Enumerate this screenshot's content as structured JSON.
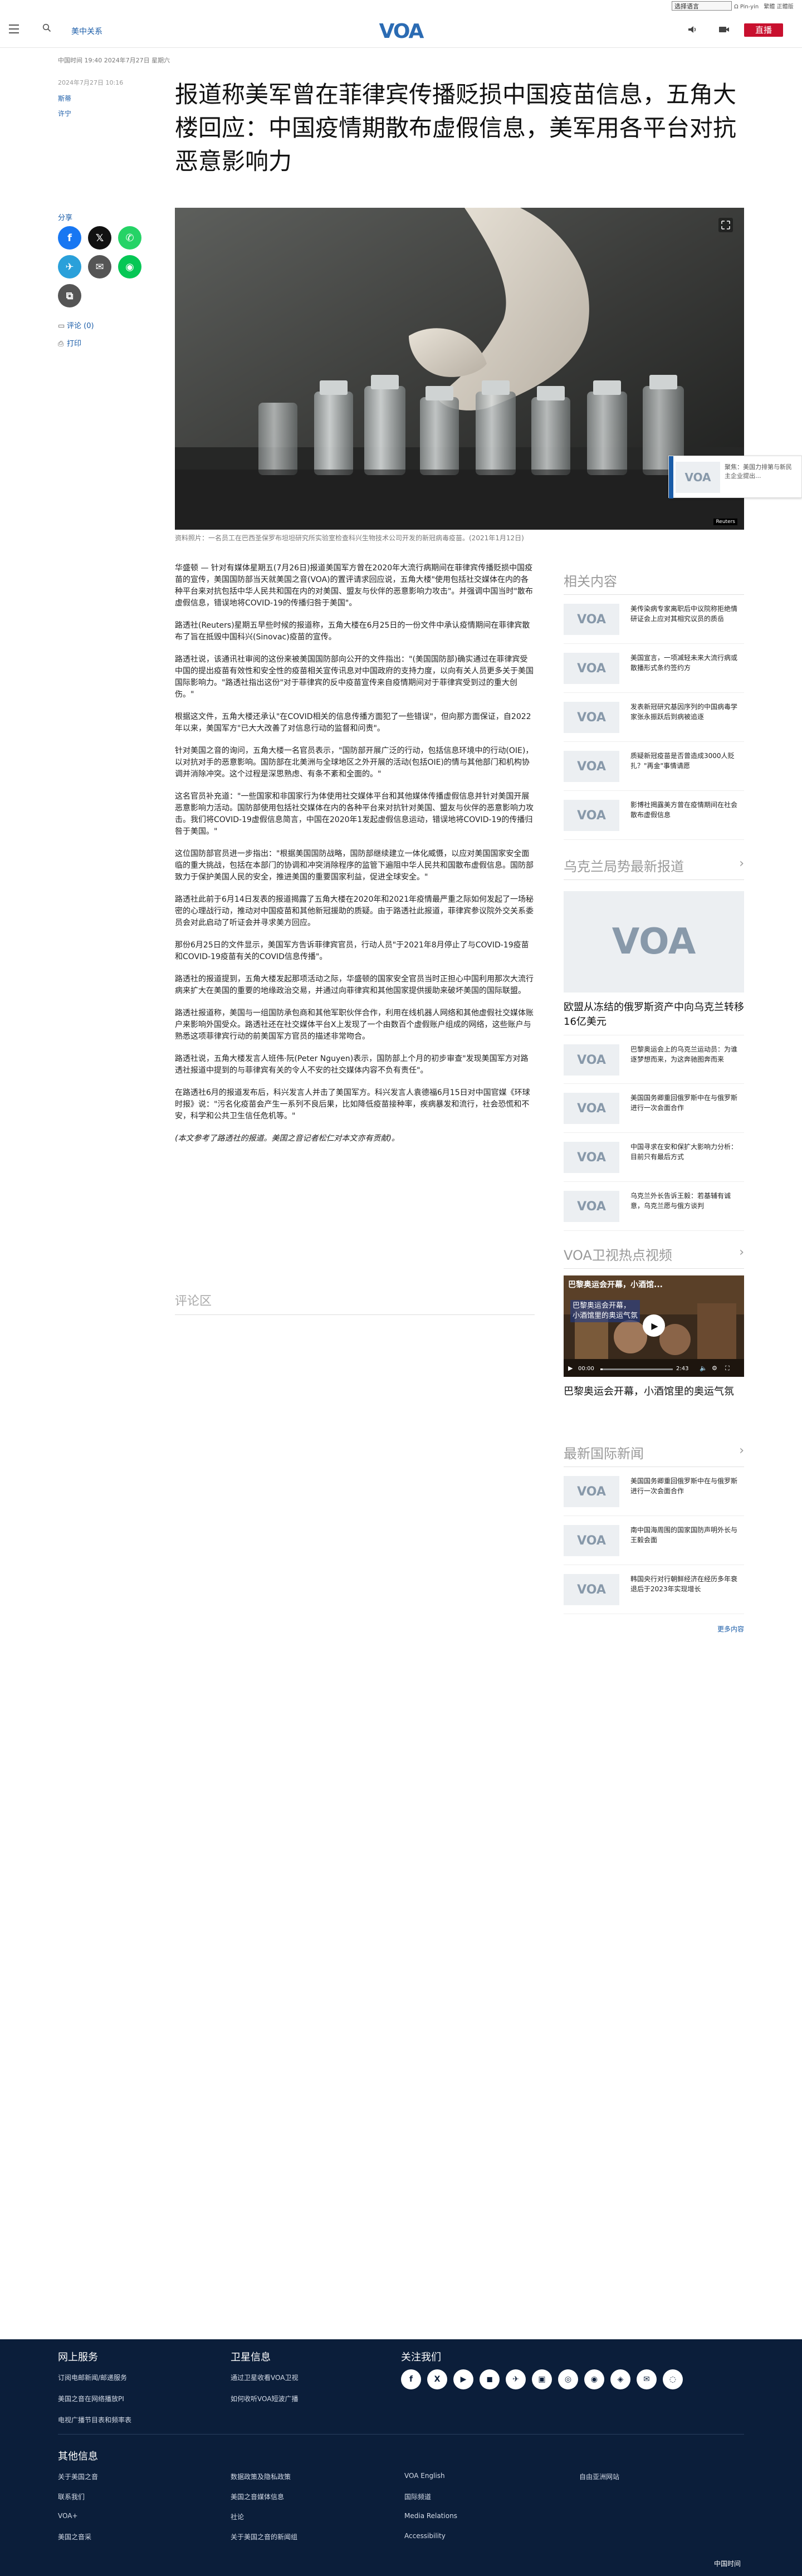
{
  "util": {
    "language_select": "选择语言",
    "links": [
      "Ω Pin-yin",
      "繁體 正體版"
    ]
  },
  "header": {
    "section": "美中关系",
    "logo": "VOA",
    "live": "直播"
  },
  "article": {
    "meta": "中国时间 19:40 2024年7月27日 星期六",
    "date_line": "2024年7月27日 10:16",
    "authors": [
      "斯蒂",
      "许宁"
    ],
    "headline": "报道称美军曾在菲律宾传播贬损中国疫苗信息，五角大楼回应：中国疫情期散布虚假信息，美军用各平台对抗恶意影响力",
    "share_label": "分享",
    "comments_link": "评论 (0)",
    "print_link": "打印",
    "caption": "资料照片：一名员工在巴西圣保罗布坦坦研究所实验室检查科兴生物技术公司开发的新冠病毒疫苗。(2021年1月12日)",
    "hero_badge": "Reuters",
    "paragraphs": [
      "华盛顿 — 针对有媒体星期五(7月26日)报道美国军方曾在2020年大流行病期间在菲律宾传播贬损中国疫苗的宣传，美国国防部当天就美国之音(VOA)的置评请求回应说，五角大楼\"使用包括社交媒体在内的各种平台来对抗包括中华人民共和国在内的对美国、盟友与伙伴的恶意影响力攻击\"。并强调中国当时\"散布虚假信息，错误地将COVID-19的传播归咎于美国\"。",
      "路透社(Reuters)星期五早些时候的报道称，五角大楼在6月25日的一份文件中承认疫情期间在菲律宾散布了旨在抵毁中国科兴(Sinovac)疫苗的宣传。",
      "路透社说，该通讯社审阅的这份来被美国国防部向公开的文件指出：\"(美国国防部)确实通过在菲律宾受中国的提出疫苗有效性和安全性的疫苗相关宣传讯息对中国政府的支持力度，以向有关人员更多关于美国国际影响力。\"路透社指出这份\"对于菲律宾的反中疫苗宣传来自疫情期间对于菲律宾受到过的重大创伤。\"",
      "根据这文件，五角大楼还承认\"在COVID相关的信息传播方面犯了一些错误\"，但向那方面保证，自2022年以来，美国军方\"已大大改善了对信息行动的监督和问责\"。",
      "针对美国之音的询问，五角大楼一名官员表示，\"国防部开展广泛的行动，包括信息环境中的行动(OIE)，以对抗对手的恶意影响。国防部在北美洲与全球地区之外开展的活动(包括OIE)的情与其他部门和机构协调并消除冲突。这个过程是深思熟虑、有条不紊和全面的。\"",
      "这名官员补充道：\"一些国家和非国家行为体使用社交媒体平台和其他媒体传播虚假信息并针对美国开展恶意影响力活动。国防部使用包括社交媒体在内的各种平台来对抗针对美国、盟友与伙伴的恶意影响力攻击。我们将COVID-19虚假信息简言，中国在2020年1发起虚假信息运动，错误地将COVID-19的传播归咎于美国。\"",
      "这位国防部官员进一步指出：\"根据美国国防战略，国防部继续建立一体化威慑，以应对美国国家安全面临的重大挑战，包括在本部门的协调和冲突消除程序的监管下遍阻中华人民共和国散布虚假信息。国防部致力于保护美国人民的安全，推进美国的重要国家利益，促进全球安全。\"",
      "路透社此前于6月14日发表的报道揭露了五角大楼在2020年和2021年疫情最严重之际如何发起了一场秘密的心理战行动，推动对中国疫苗和其他新冠援助的质疑。由于路透社此报道，菲律宾参议院外交关系委员会对此启动了听证会并寻求美方回应。",
      "那份6月25日的文件显示，美国军方告诉菲律宾官员，行动人员\"于2021年8月停止了与COVID-19疫苗和COVID-19疫苗有关的COVID信息传播\"。",
      "路透社的报道提到，五角大楼发起那项活动之际，华盛顿的国家安全官员当时正担心中国利用那次大流行病来扩大在美国的重要的地缘政治交易，并通过向菲律宾和其他国家提供援助来破坏美国的国际联盟。",
      "路透社报道称，美国与一组国防承包商和其他军职伙伴合作，利用在线机器人网络和其他虚假社交媒体账户来影响外国受众。路透社还在社交媒体平台X上发现了一个由数百个虚假账户组成的网络，这些账户与熟悉这项菲律宾行动的前美国军方官员的描述非常吻合。",
      "路透社说，五角大楼发言人班伟·阮(Peter Nguyen)表示，国防部上个月的初步审查\"发现美国军方对路透社报道中提到的与菲律宾有关的令人不安的社交媒体内容不负有责任\"。",
      "在路透社6月的报道发布后，科兴发言人并击了美国军方。科兴发言人袁德福6月15日对中国官媒《环球时报》说：\"污名化疫苗会产生一系列不良后果，比如降低疫苗接种率，疾病暴发和流行，社会恐慌和不安，科学和公共卫生信任危机等。\"",
      "(本文参考了路透社的报道。美国之音记者松仁对本文亦有贡献)。"
    ],
    "comments_heading": "评论区"
  },
  "related": {
    "heading": "相关内容",
    "items": [
      "美传染病专家离职后中议院称拒绝情研证会上应对其相究议员的质岳",
      "美国宣言，一项减轻未来大流行病或散播形式条约签约方",
      "发表新冠研究基因序列的中国病毒学家张永振跃后到病被追逐",
      "质疑新冠疫苗是否曾造成3000人贬扎？\"再金\"事情请愿",
      "影博社揭露美方曾在疫情期间在社会散布虚假信息"
    ]
  },
  "ukraine": {
    "heading": "乌克兰局势最新报道",
    "lead_title": "欧盟从冻结的俄罗斯资产中向乌克兰转移16亿美元",
    "items": [
      "巴黎奥运会上的乌克兰运动员：为谁逐梦想而来，为这奔驰图奔而来",
      "美国国务卿重回俄罗斯中在与俄罗斯进行一次会面合作",
      "中国寻求在安和保扩大影响力分析：目前只有最后方式",
      "乌克兰外长告诉王毅：若基辅有诚意，乌克兰愿与俄方谈判"
    ]
  },
  "video": {
    "heading": "VOA卫视热点视频",
    "overlay_title": "巴黎奥运会开幕，小酒馆...",
    "overlay_sub": "巴黎奥运会开幕，\n小酒馆里的奥运气氛",
    "time": "00:00",
    "duration": "2:43",
    "title": "巴黎奥运会开幕，小酒馆里的奥运气氛"
  },
  "intl": {
    "heading": "最新国际新闻",
    "items": [
      "美国国务卿重回俄罗斯中在与俄罗斯进行一次会面合作",
      "南中国海周围的国家国防声明外长与王毅会面",
      "韩国央行对行朝鲜经济在经历多年衰退后于2023年实现增长"
    ],
    "more": "更多内容"
  },
  "float_card": {
    "text": "聚焦：美国力排第与新民主企业提出..."
  },
  "footer": {
    "online": {
      "heading": "网上服务",
      "links": [
        "订阅电邮新闻/邮递服务",
        "美国之音在网络播放PI",
        "电视广播节目表和频率表"
      ]
    },
    "satellite": {
      "heading": "卫星信息",
      "links": [
        "通过卫星收看VOA卫视",
        "如何收听VOA短波广播"
      ]
    },
    "follow": {
      "heading": "关注我们"
    },
    "social": [
      "f",
      "X",
      "▶",
      "◼",
      "✈",
      "▣",
      "◎",
      "◉",
      "◈",
      "✉",
      "◌"
    ],
    "other": {
      "heading": "其他信息",
      "col1": [
        "关于美国之音",
        "联系我们",
        "VOA+",
        "美国之音采"
      ],
      "col2": [
        "数据政策及隐私政策",
        "美国之音媒体信息",
        "社论",
        "关于美国之音的新闻组"
      ],
      "col3": [
        "VOA English",
        "国际频道",
        "Media Relations",
        "Accessibility"
      ],
      "col4": [
        "自由亚洲网站"
      ]
    },
    "copyright": "中国时间"
  }
}
